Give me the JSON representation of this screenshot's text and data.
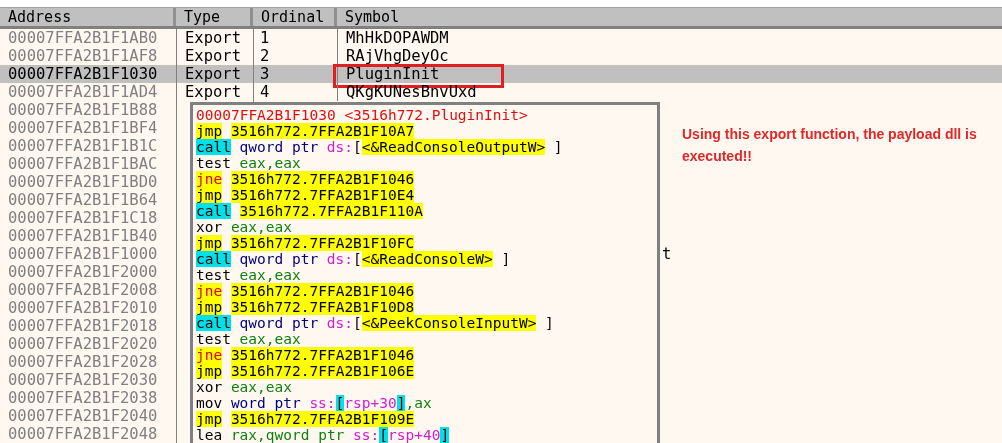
{
  "table": {
    "columns": [
      "Address",
      "Type",
      "Ordinal",
      "Symbol"
    ],
    "rows": [
      {
        "address": "00007FFA2B1F1AB0",
        "type": "Export",
        "ordinal": "1",
        "symbol": "MhHkDOPAWDM",
        "selected": false
      },
      {
        "address": "00007FFA2B1F1AF8",
        "type": "Export",
        "ordinal": "2",
        "symbol": "RAjVhgDeyOc",
        "selected": false
      },
      {
        "address": "00007FFA2B1F1030",
        "type": "Export",
        "ordinal": "3",
        "symbol": "PluginInit",
        "selected": true
      },
      {
        "address": "00007FFA2B1F1AD4",
        "type": "Export",
        "ordinal": "4",
        "symbol": "QKgKUNesBnvUxd",
        "selected": false
      },
      {
        "address": "00007FFA2B1F1B88",
        "selected": false
      },
      {
        "address": "00007FFA2B1F1BF4",
        "selected": false
      },
      {
        "address": "00007FFA2B1F1B1C",
        "selected": false
      },
      {
        "address": "00007FFA2B1F1BAC",
        "selected": false
      },
      {
        "address": "00007FFA2B1F1BD0",
        "selected": false
      },
      {
        "address": "00007FFA2B1F1B64",
        "selected": false
      },
      {
        "address": "00007FFA2B1F1C18",
        "selected": false
      },
      {
        "address": "00007FFA2B1F1B40",
        "selected": false
      },
      {
        "address": "00007FFA2B1F1000",
        "symbol": "t",
        "selected": false
      },
      {
        "address": "00007FFA2B1F2000",
        "selected": false
      },
      {
        "address": "00007FFA2B1F2008",
        "selected": false
      },
      {
        "address": "00007FFA2B1F2010",
        "selected": false
      },
      {
        "address": "00007FFA2B1F2018",
        "selected": false
      },
      {
        "address": "00007FFA2B1F2020",
        "selected": false
      },
      {
        "address": "00007FFA2B1F2028",
        "selected": false
      },
      {
        "address": "00007FFA2B1F2030",
        "selected": false
      },
      {
        "address": "00007FFA2B1F2038",
        "selected": false
      },
      {
        "address": "00007FFA2B1F2040",
        "selected": false
      },
      {
        "address": "00007FFA2B1F2048",
        "selected": false
      }
    ]
  },
  "popup": {
    "lines": [
      [
        [
          {
            "text": "00007FFA2B1F1030",
            "kind": "title"
          }
        ],
        [
          {
            "text": "<3516h772.PluginInit>",
            "kind": "title"
          }
        ]
      ],
      [
        [
          {
            "text": "jmp",
            "kind": "jump"
          }
        ],
        [
          {
            "text": "3516h772.7FFA2B1F10A7",
            "kind": "target"
          }
        ]
      ],
      [
        [
          {
            "text": "call",
            "kind": "call"
          }
        ],
        [
          {
            "text": "qword",
            "kind": "size"
          }
        ],
        [
          {
            "text": "ptr",
            "kind": "size"
          }
        ],
        [
          {
            "text": "ds:",
            "kind": "segment"
          },
          {
            "text": "[",
            "kind": "plain"
          },
          {
            "text": "<&ReadConsoleOutputW>",
            "kind": "target"
          }
        ],
        [
          {
            "text": "]",
            "kind": "plain"
          }
        ]
      ],
      [
        [
          {
            "text": "test",
            "kind": "plain"
          }
        ],
        [
          {
            "text": "eax,eax",
            "kind": "register"
          }
        ]
      ],
      [
        [
          {
            "text": "jne",
            "kind": "cond"
          }
        ],
        [
          {
            "text": "3516h772.7FFA2B1F1046",
            "kind": "target"
          }
        ]
      ],
      [
        [
          {
            "text": "jmp",
            "kind": "jump"
          }
        ],
        [
          {
            "text": "3516h772.7FFA2B1F10E4",
            "kind": "target"
          }
        ]
      ],
      [
        [
          {
            "text": "call",
            "kind": "call"
          }
        ],
        [
          {
            "text": "3516h772.7FFA2B1F110A",
            "kind": "target"
          }
        ]
      ],
      [
        [
          {
            "text": "xor",
            "kind": "plain"
          }
        ],
        [
          {
            "text": "eax,eax",
            "kind": "register"
          }
        ]
      ],
      [
        [
          {
            "text": "jmp",
            "kind": "jump"
          }
        ],
        [
          {
            "text": "3516h772.7FFA2B1F10FC",
            "kind": "target"
          }
        ]
      ],
      [
        [
          {
            "text": "call",
            "kind": "call"
          }
        ],
        [
          {
            "text": "qword",
            "kind": "size"
          }
        ],
        [
          {
            "text": "ptr",
            "kind": "size"
          }
        ],
        [
          {
            "text": "ds:",
            "kind": "segment"
          },
          {
            "text": "[",
            "kind": "plain"
          },
          {
            "text": "<&ReadConsoleW>",
            "kind": "target"
          }
        ],
        [
          {
            "text": "]",
            "kind": "plain"
          }
        ]
      ],
      [
        [
          {
            "text": "test",
            "kind": "plain"
          }
        ],
        [
          {
            "text": "eax,eax",
            "kind": "register"
          }
        ]
      ],
      [
        [
          {
            "text": "jne",
            "kind": "cond"
          }
        ],
        [
          {
            "text": "3516h772.7FFA2B1F1046",
            "kind": "target"
          }
        ]
      ],
      [
        [
          {
            "text": "jmp",
            "kind": "jump"
          }
        ],
        [
          {
            "text": "3516h772.7FFA2B1F10D8",
            "kind": "target"
          }
        ]
      ],
      [
        [
          {
            "text": "call",
            "kind": "call"
          }
        ],
        [
          {
            "text": "qword",
            "kind": "size"
          }
        ],
        [
          {
            "text": "ptr",
            "kind": "size"
          }
        ],
        [
          {
            "text": "ds:",
            "kind": "segment"
          },
          {
            "text": "[",
            "kind": "plain"
          },
          {
            "text": "<&PeekConsoleInputW>",
            "kind": "target"
          }
        ],
        [
          {
            "text": "]",
            "kind": "plain"
          }
        ]
      ],
      [
        [
          {
            "text": "test",
            "kind": "plain"
          }
        ],
        [
          {
            "text": "eax,eax",
            "kind": "register"
          }
        ]
      ],
      [
        [
          {
            "text": "jne",
            "kind": "cond"
          }
        ],
        [
          {
            "text": "3516h772.7FFA2B1F1046",
            "kind": "target"
          }
        ]
      ],
      [
        [
          {
            "text": "jmp",
            "kind": "jump"
          }
        ],
        [
          {
            "text": "3516h772.7FFA2B1F106E",
            "kind": "target"
          }
        ]
      ],
      [
        [
          {
            "text": "xor",
            "kind": "plain"
          }
        ],
        [
          {
            "text": "eax,eax",
            "kind": "register"
          }
        ]
      ],
      [
        [
          {
            "text": "mov",
            "kind": "plain"
          }
        ],
        [
          {
            "text": "word",
            "kind": "size"
          }
        ],
        [
          {
            "text": "ptr",
            "kind": "size"
          }
        ],
        [
          {
            "text": "ss:",
            "kind": "segment"
          },
          {
            "text": "[",
            "kind": "bracket"
          },
          {
            "text": "rsp+30",
            "kind": "segment"
          },
          {
            "text": "]",
            "kind": "bracket"
          },
          {
            "text": ",ax",
            "kind": "register"
          }
        ]
      ],
      [
        [
          {
            "text": "jmp",
            "kind": "jump"
          }
        ],
        [
          {
            "text": "3516h772.7FFA2B1F109E",
            "kind": "target"
          }
        ]
      ],
      [
        [
          {
            "text": "lea",
            "kind": "plain"
          }
        ],
        [
          {
            "text": "rax,qword",
            "kind": "register"
          }
        ],
        [
          {
            "text": "ptr",
            "kind": "register"
          }
        ],
        [
          {
            "text": "ss:",
            "kind": "segment"
          },
          {
            "text": "[",
            "kind": "bracket"
          },
          {
            "text": "rsp+40",
            "kind": "segment"
          },
          {
            "text": "]",
            "kind": "bracket"
          }
        ]
      ]
    ]
  },
  "annotation": "Using this export function, the payload dll is executed!!"
}
